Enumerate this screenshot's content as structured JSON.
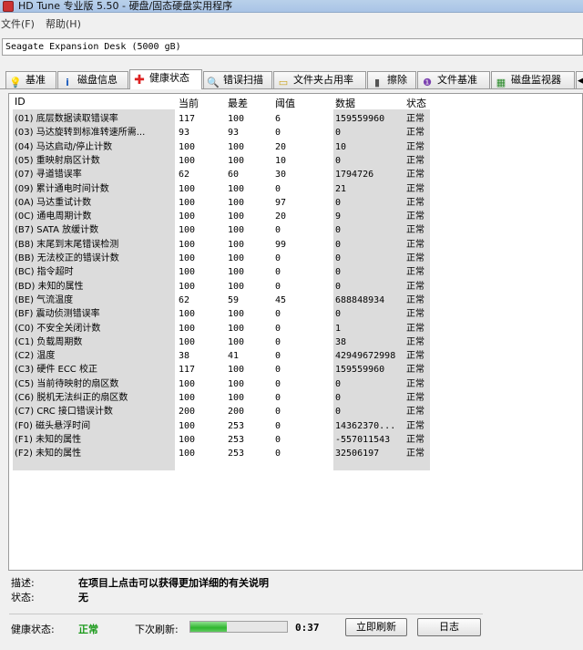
{
  "window": {
    "title": "HD Tune 专业版 5.50 - 硬盘/固态硬盘实用程序"
  },
  "menu": {
    "file": "文件(F)",
    "help": "帮助(H)"
  },
  "drive": {
    "selected": "Seagate Expansion Desk (5000 gB)"
  },
  "tabs": [
    {
      "label": "基准",
      "icon": "benchmark-icon"
    },
    {
      "label": "磁盘信息",
      "icon": "info-icon"
    },
    {
      "label": "健康状态",
      "icon": "health-cross-icon",
      "active": true
    },
    {
      "label": "错误扫描",
      "icon": "magnifier-icon"
    },
    {
      "label": "文件夹占用率",
      "icon": "folder-icon"
    },
    {
      "label": "擦除",
      "icon": "trash-icon"
    },
    {
      "label": "文件基准",
      "icon": "file-benchmark-icon"
    },
    {
      "label": "磁盘监视器",
      "icon": "monitor-icon"
    }
  ],
  "table": {
    "headers": {
      "id": "ID",
      "current": "当前",
      "worst": "最差",
      "threshold": "阈值",
      "data": "数据",
      "status": "状态"
    },
    "rows": [
      {
        "name": "(01) 底层数据读取错误率",
        "current": "117",
        "worst": "100",
        "threshold": "6",
        "data": "159559960",
        "status": "正常"
      },
      {
        "name": "(03) 马达旋转到标准转速所需...",
        "current": "93",
        "worst": "93",
        "threshold": "0",
        "data": "0",
        "status": "正常"
      },
      {
        "name": "(04) 马达启动/停止计数",
        "current": "100",
        "worst": "100",
        "threshold": "20",
        "data": "10",
        "status": "正常"
      },
      {
        "name": "(05) 重映射扇区计数",
        "current": "100",
        "worst": "100",
        "threshold": "10",
        "data": "0",
        "status": "正常"
      },
      {
        "name": "(07) 寻道错误率",
        "current": "62",
        "worst": "60",
        "threshold": "30",
        "data": "1794726",
        "status": "正常"
      },
      {
        "name": "(09) 累计通电时间计数",
        "current": "100",
        "worst": "100",
        "threshold": "0",
        "data": "21",
        "status": "正常"
      },
      {
        "name": "(0A) 马达重试计数",
        "current": "100",
        "worst": "100",
        "threshold": "97",
        "data": "0",
        "status": "正常"
      },
      {
        "name": "(0C) 通电周期计数",
        "current": "100",
        "worst": "100",
        "threshold": "20",
        "data": "9",
        "status": "正常"
      },
      {
        "name": "(B7) SATA 放缓计数",
        "current": "100",
        "worst": "100",
        "threshold": "0",
        "data": "0",
        "status": "正常"
      },
      {
        "name": "(B8) 末尾到末尾错误检测",
        "current": "100",
        "worst": "100",
        "threshold": "99",
        "data": "0",
        "status": "正常"
      },
      {
        "name": "(BB) 无法校正的错误计数",
        "current": "100",
        "worst": "100",
        "threshold": "0",
        "data": "0",
        "status": "正常"
      },
      {
        "name": "(BC) 指令超时",
        "current": "100",
        "worst": "100",
        "threshold": "0",
        "data": "0",
        "status": "正常"
      },
      {
        "name": "(BD) 未知的属性",
        "current": "100",
        "worst": "100",
        "threshold": "0",
        "data": "0",
        "status": "正常"
      },
      {
        "name": "(BE) 气流温度",
        "current": "62",
        "worst": "59",
        "threshold": "45",
        "data": "688848934",
        "status": "正常"
      },
      {
        "name": "(BF) 震动侦测错误率",
        "current": "100",
        "worst": "100",
        "threshold": "0",
        "data": "0",
        "status": "正常"
      },
      {
        "name": "(C0) 不安全关闭计数",
        "current": "100",
        "worst": "100",
        "threshold": "0",
        "data": "1",
        "status": "正常"
      },
      {
        "name": "(C1) 负载周期数",
        "current": "100",
        "worst": "100",
        "threshold": "0",
        "data": "38",
        "status": "正常"
      },
      {
        "name": "(C2) 温度",
        "current": "38",
        "worst": "41",
        "threshold": "0",
        "data": "42949672998",
        "status": "正常"
      },
      {
        "name": "(C3) 硬件 ECC 校正",
        "current": "117",
        "worst": "100",
        "threshold": "0",
        "data": "159559960",
        "status": "正常"
      },
      {
        "name": "(C5) 当前待映射的扇区数",
        "current": "100",
        "worst": "100",
        "threshold": "0",
        "data": "0",
        "status": "正常"
      },
      {
        "name": "(C6) 脱机无法纠正的扇区数",
        "current": "100",
        "worst": "100",
        "threshold": "0",
        "data": "0",
        "status": "正常"
      },
      {
        "name": "(C7) CRC 接口错误计数",
        "current": "200",
        "worst": "200",
        "threshold": "0",
        "data": "0",
        "status": "正常"
      },
      {
        "name": "(F0) 磁头悬浮时间",
        "current": "100",
        "worst": "253",
        "threshold": "0",
        "data": "14362370...",
        "status": "正常"
      },
      {
        "name": "(F1) 未知的属性",
        "current": "100",
        "worst": "253",
        "threshold": "0",
        "data": "-557011543",
        "status": "正常"
      },
      {
        "name": "(F2) 未知的属性",
        "current": "100",
        "worst": "253",
        "threshold": "0",
        "data": "32506197",
        "status": "正常"
      }
    ]
  },
  "info": {
    "description_label": "描述:",
    "description_value": "在项目上点击可以获得更加详细的有关说明",
    "status_label": "状态:",
    "status_value": "无"
  },
  "footer": {
    "health_label": "健康状态:",
    "health_value": "正常",
    "refresh_label": "下次刷新:",
    "refresh_progress": 0.38,
    "countdown": "0:37",
    "refresh_button": "立即刷新",
    "log_button": "日志"
  },
  "colors": {
    "ok_green": "#1a9a1a",
    "progress_green": "#2fb52f",
    "titlebar": "#b9d1ea"
  }
}
